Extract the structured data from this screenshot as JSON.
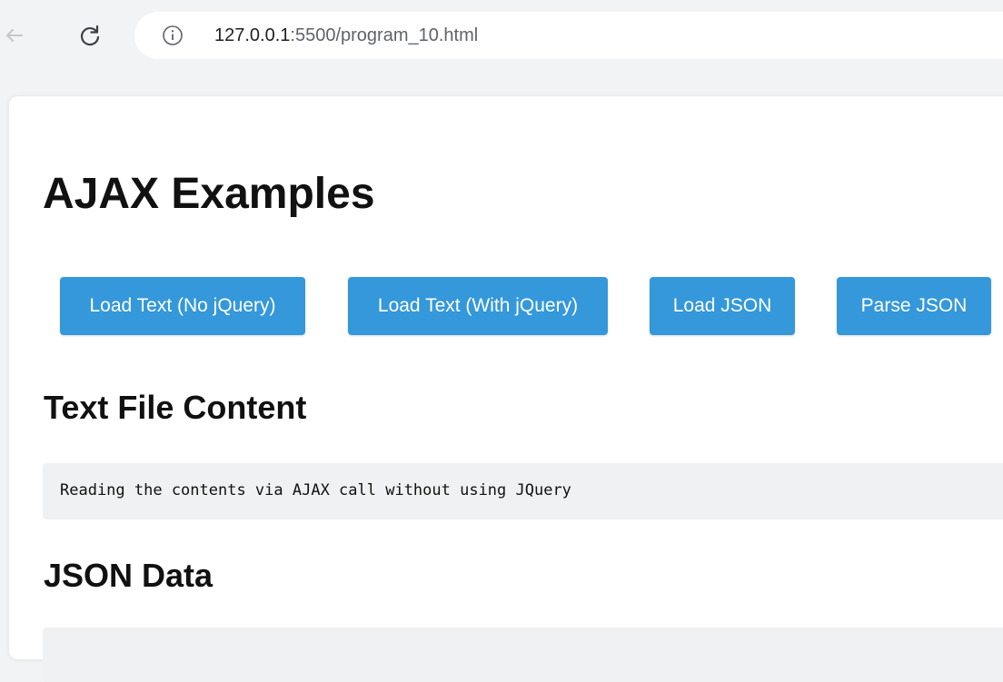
{
  "browser": {
    "url_host": "127.0.0.1",
    "url_rest": ":5500/program_10.html"
  },
  "page": {
    "title": "AJAX Examples",
    "buttons": [
      {
        "label": "Load Text (No jQuery)"
      },
      {
        "label": "Load Text (With jQuery)"
      },
      {
        "label": "Load JSON"
      },
      {
        "label": "Parse JSON"
      }
    ],
    "text_section": {
      "heading": "Text File Content",
      "content": "Reading the contents via AJAX call without using JQuery"
    },
    "json_section": {
      "heading": "JSON Data",
      "content": ""
    }
  },
  "icons": {
    "back": "back-arrow-icon",
    "reload": "reload-icon",
    "info": "info-icon"
  },
  "colors": {
    "button_bg": "#3498db",
    "button_text": "#ffffff",
    "output_bg": "#f0f1f2"
  }
}
